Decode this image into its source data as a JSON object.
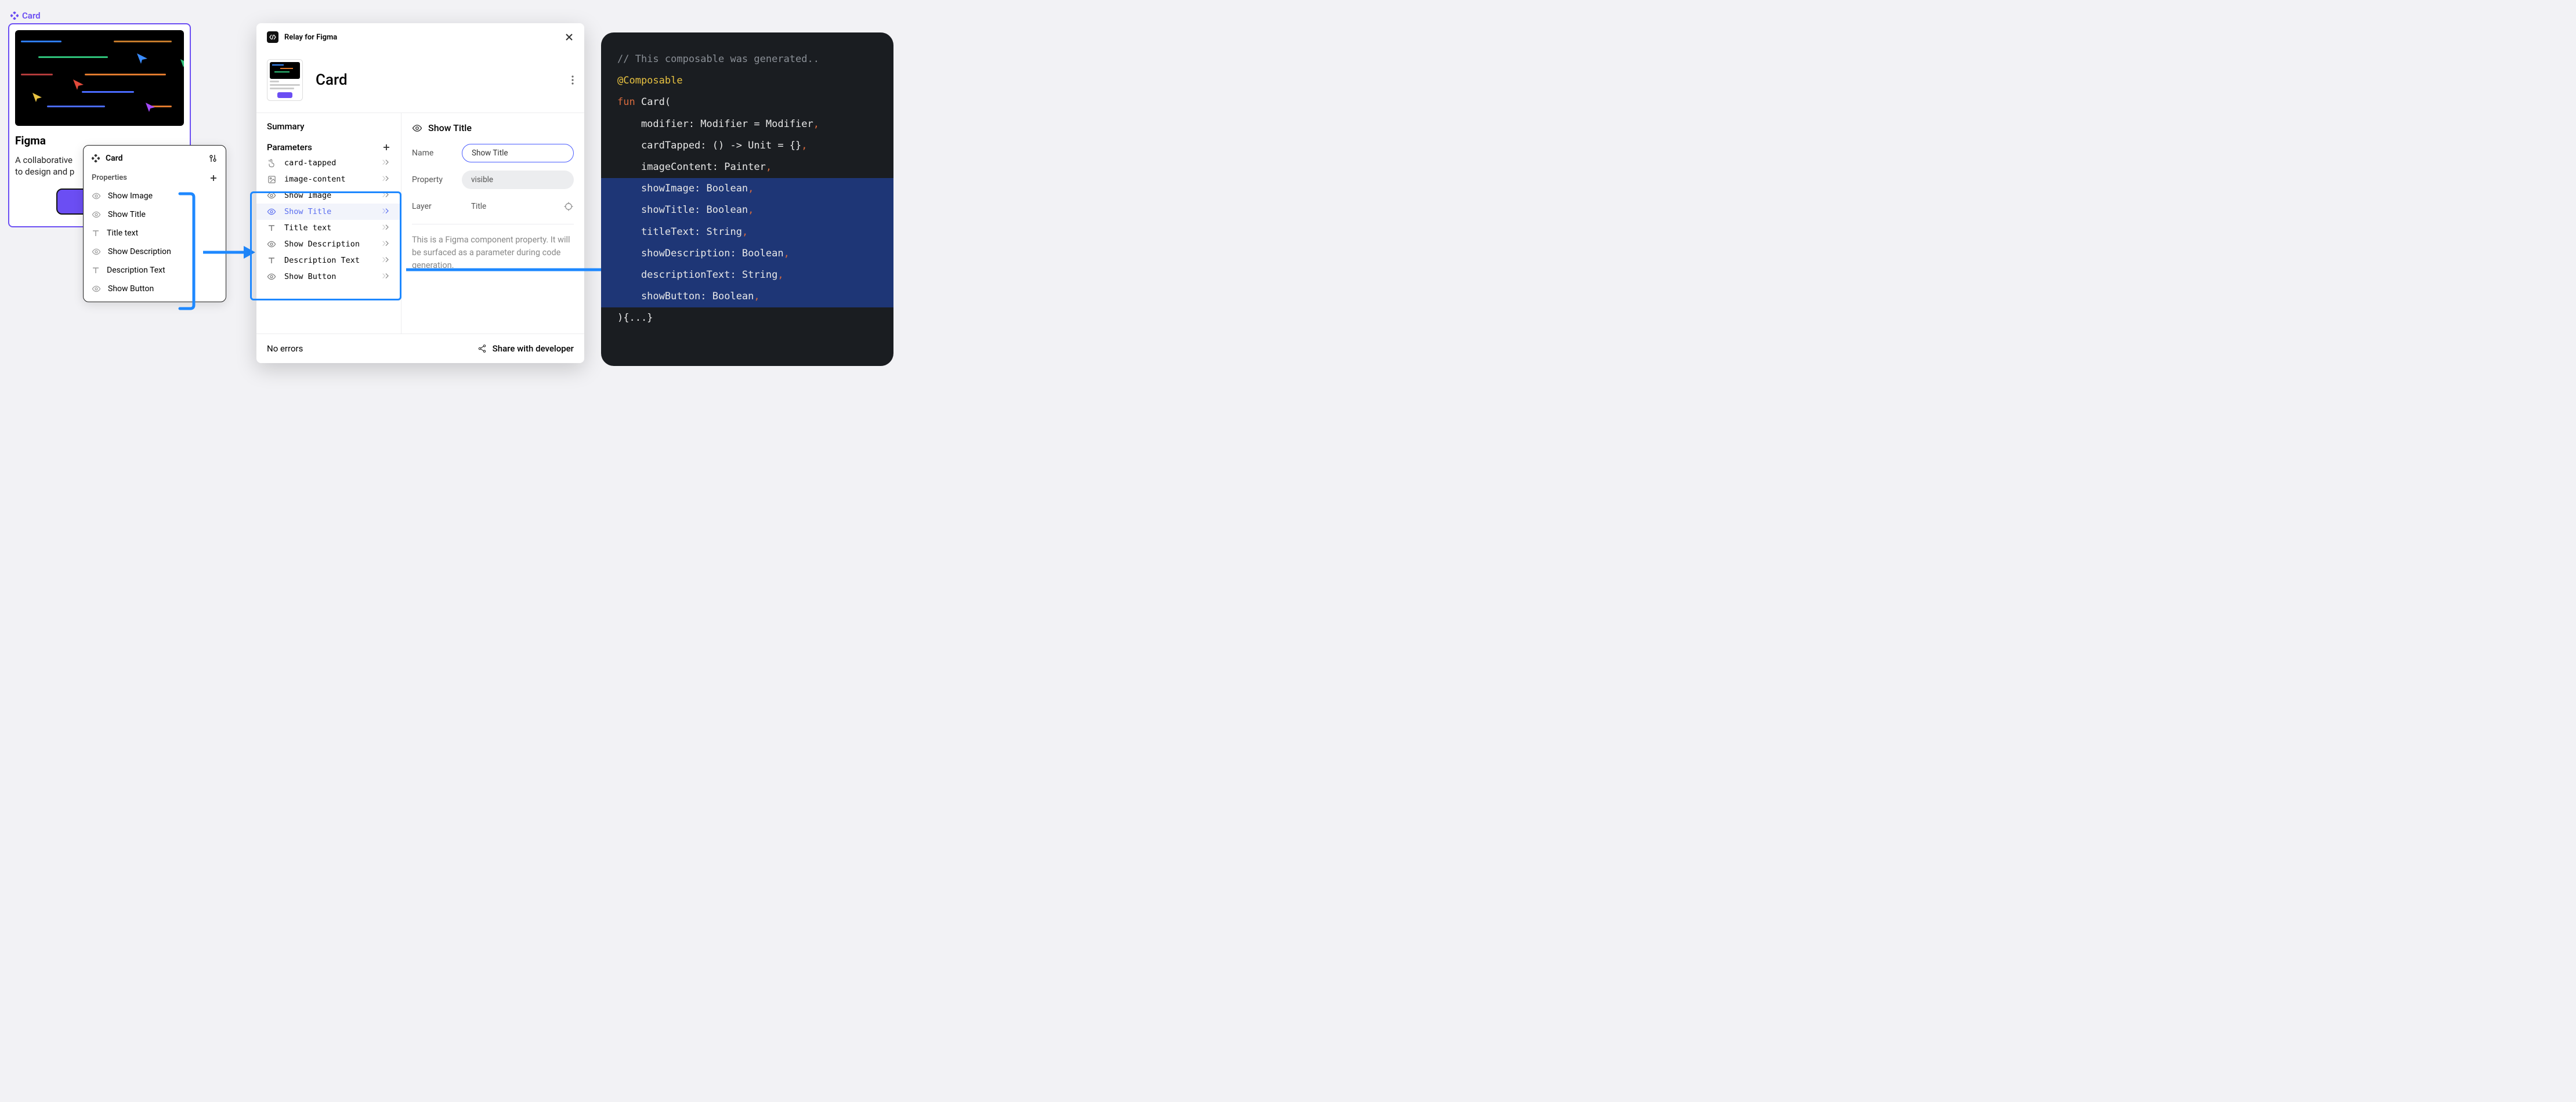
{
  "figma_label": "Card",
  "card_preview": {
    "title": "Figma",
    "description": "A collaborative design tool for teams to design and prototype together.",
    "truncated_description": "A collaborative \nto design and p"
  },
  "properties_panel": {
    "title": "Card",
    "section": "Properties",
    "items": [
      {
        "icon": "eye",
        "label": "Show Image"
      },
      {
        "icon": "eye",
        "label": "Show Title"
      },
      {
        "icon": "text",
        "label": "Title text"
      },
      {
        "icon": "eye",
        "label": "Show Description"
      },
      {
        "icon": "text",
        "label": "Description Text"
      },
      {
        "icon": "eye",
        "label": "Show Button"
      }
    ]
  },
  "relay": {
    "app_title": "Relay for Figma",
    "component_name": "Card",
    "summary_label": "Summary",
    "parameters_label": "Parameters",
    "parameters": [
      {
        "icon": "tap",
        "label": "card-tapped",
        "selected": false
      },
      {
        "icon": "image",
        "label": "image-content",
        "selected": false
      },
      {
        "icon": "eye",
        "label": "Show Image",
        "selected": false
      },
      {
        "icon": "eye",
        "label": "Show Title",
        "selected": true
      },
      {
        "icon": "text",
        "label": "Title text",
        "selected": false
      },
      {
        "icon": "eye",
        "label": "Show Description",
        "selected": false
      },
      {
        "icon": "text",
        "label": "Description Text",
        "selected": false
      },
      {
        "icon": "eye",
        "label": "Show Button",
        "selected": false
      }
    ],
    "detail_title": "Show Title",
    "name_label": "Name",
    "name_value": "Show Title",
    "property_label": "Property",
    "property_value": "visible",
    "layer_label": "Layer",
    "layer_value": "Title",
    "help_text": "This is a Figma component property. It will be surfaced as a parameter during code generation.",
    "footer_left": "No errors",
    "footer_right": "Share with developer"
  },
  "code": {
    "lines": [
      {
        "hl": false,
        "tokens": [
          {
            "c": "c-comment",
            "t": "// This composable was generated.."
          }
        ]
      },
      {
        "hl": false,
        "tokens": [
          {
            "c": "c-ann",
            "t": "@Composable"
          }
        ]
      },
      {
        "hl": false,
        "tokens": [
          {
            "c": "c-kw",
            "t": "fun "
          },
          {
            "c": "",
            "t": "Card("
          }
        ]
      },
      {
        "hl": false,
        "tokens": [
          {
            "c": "",
            "t": "    modifier: Modifier = Modifier"
          },
          {
            "c": "c-op",
            "t": ","
          }
        ]
      },
      {
        "hl": false,
        "tokens": [
          {
            "c": "",
            "t": "    cardTapped: () -> Unit = {}"
          },
          {
            "c": "c-op",
            "t": ","
          }
        ]
      },
      {
        "hl": false,
        "tokens": [
          {
            "c": "",
            "t": "    imageContent: Painter"
          },
          {
            "c": "c-op",
            "t": ","
          }
        ]
      },
      {
        "hl": true,
        "tokens": [
          {
            "c": "",
            "t": "    showImage: Boolean"
          },
          {
            "c": "c-op",
            "t": ","
          }
        ]
      },
      {
        "hl": true,
        "tokens": [
          {
            "c": "",
            "t": "    showTitle: Boolean"
          },
          {
            "c": "c-op",
            "t": ","
          }
        ]
      },
      {
        "hl": true,
        "tokens": [
          {
            "c": "",
            "t": "    titleText: String"
          },
          {
            "c": "c-op",
            "t": ","
          }
        ]
      },
      {
        "hl": true,
        "tokens": [
          {
            "c": "",
            "t": "    showDescription: Boolean"
          },
          {
            "c": "c-op",
            "t": ","
          }
        ]
      },
      {
        "hl": true,
        "tokens": [
          {
            "c": "",
            "t": "    descriptionText: String"
          },
          {
            "c": "c-op",
            "t": ","
          }
        ]
      },
      {
        "hl": true,
        "tokens": [
          {
            "c": "",
            "t": "    showButton: Boolean"
          },
          {
            "c": "c-op",
            "t": ","
          }
        ]
      },
      {
        "hl": false,
        "tokens": [
          {
            "c": "",
            "t": "){...}"
          }
        ]
      }
    ]
  }
}
